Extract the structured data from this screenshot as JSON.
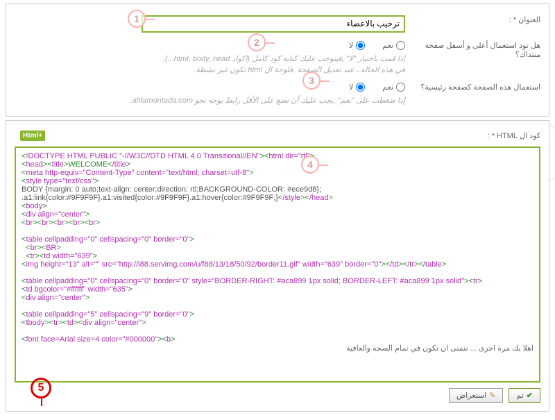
{
  "top": {
    "title_label": "العنوان * :",
    "title_value": "ترحيب بالاعضاء",
    "q1_label": "هل تود استعمال أعلى و أسفل صفحة منتداك؟",
    "q1_yes": "نعم",
    "q1_no": "لا",
    "q1_hint1": "إذا قمت باختيار \"لا\" ,فيتوجب عليك كتابة كود كامل (اكواد html, body, head...).",
    "q1_hint2": "في هذه الحالة ، عند تعديل الصفحة ,فلوحة ال html تكون غير نشطة.",
    "q2_label": "استعمال هذه الصفحة كصفحة رئيسية؟",
    "q2_yes": "نعم",
    "q2_no": "لا",
    "q2_hint": "إذا ضغطت على \"نعم\" ,يجب عليك أن تضع على الأقل رابط يوجه نحو ahlamontada.com."
  },
  "code": {
    "label": "كود ال HTML * :",
    "badge": "Html",
    "l1a": "<",
    "l1b": "!DOCTYPE HTML PUBLIC \"-//W3C//DTD HTML 4.0 Transitional//EN\"",
    "l1c": "><",
    "l1d": "html dir=\"rtl\"",
    "l1e": ">",
    "l2a": "<",
    "l2b": "head",
    "l2c": "><",
    "l2d": "title",
    "l2e": ">WELCOME<",
    "l2f": "/title",
    "l2g": ">",
    "l3a": "<",
    "l3b": "meta http-equiv=\"Content-Type\" content=\"text/html; charset=utf-8\"",
    "l3c": ">",
    "l4a": "<",
    "l4b": "style type=\"text/css\"",
    "l4c": ">",
    "l5": "BODY {margin: 0 auto;text-align: center;direction: rtl;BACKGROUND-COLOR: #ece9d8};",
    "l6a": ".a1:link{color:#9F9F9F}.a1:visited{color:#9F9F9F}.a1:hover{color:#9F9F9F;}<",
    "l6b": "/style",
    "l6c": "><",
    "l6d": "/head",
    "l6e": ">",
    "l7a": "<",
    "l7b": "body",
    "l7c": ">",
    "l8a": "<",
    "l8b": "div align=\"center\"",
    "l8c": ">",
    "l9a": "<",
    "l9b": "br",
    "l9c": "><",
    "l9d": "br",
    "l9e": "><",
    "l9f": "br",
    "l9g": "><",
    "l9h": "br",
    "l9i": "><",
    "l9j": "br",
    "l9k": ">",
    "l11a": "<",
    "l11b": "table cellpadding=\"0\" cellspacing=\"0\" border=\"0\"",
    "l11c": ">",
    "l12a": "  <",
    "l12b": "br",
    "l12c": "><",
    "l12d": "BR",
    "l12e": ">",
    "l13a": "  <",
    "l13b": "tr",
    "l13c": "><",
    "l13d": "td width=\"639\"",
    "l13e": ">",
    "l14a": "<",
    "l14b": "img height=\"13\" alt=\"\" src=\"http://i88.servimg.com/u/f88/13/18/50/92/border11.gif\" width=\"639\" border=\"0\"",
    "l14c": "><",
    "l14d": "/td",
    "l14e": "><",
    "l14f": "/tr",
    "l14g": "><",
    "l14h": "/table",
    "l14i": ">",
    "l16a": "<",
    "l16b": "table cellpadding=\"0\" cellspacing=\"0\" border=\"0\" style=\"BORDER-RIGHT: #aca899 1px solid; BORDER-LEFT: #aca899 1px solid\"",
    "l16c": "><",
    "l16d": "tr",
    "l16e": ">",
    "l17a": "<",
    "l17b": "td bgcolor=\"#ffffff\" width=\"635\"",
    "l17c": ">",
    "l18a": "<",
    "l18b": "div align=\"center\"",
    "l18c": ">",
    "l20a": "<",
    "l20b": "table cellpadding=\"5\" cellspacing=\"9\" border=\"0\"",
    "l20c": ">",
    "l21a": "<",
    "l21b": "tbody",
    "l21c": "><",
    "l21d": "tr",
    "l21e": "><",
    "l21f": "td",
    "l21g": "><",
    "l21h": "div align=\"center\"",
    "l21i": ">",
    "l23a": "<",
    "l23b": "font face=Arial size=4 color=\"#000000\"",
    "l23c": "><",
    "l23d": "b",
    "l23e": ">",
    "l24": "اهلا بك مرة اخرى ... نتمنى ان تكون في تمام الصحة والعافية"
  },
  "buttons": {
    "save": "تم",
    "preview": "استعراض"
  },
  "nums": {
    "n1": "1",
    "n2": "2",
    "n3": "3",
    "n4": "4",
    "n5": "5"
  }
}
